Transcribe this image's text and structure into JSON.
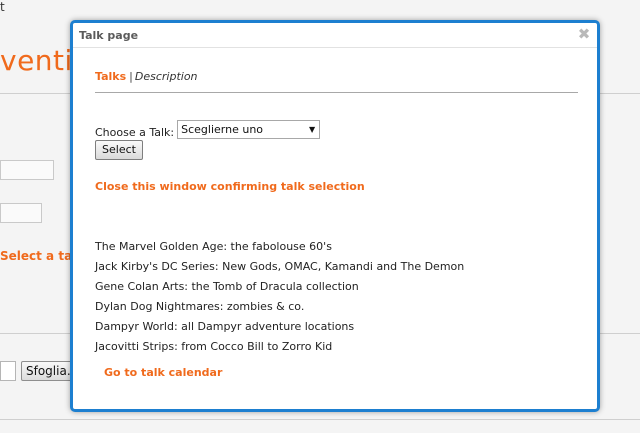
{
  "background": {
    "corner_text": "t",
    "title_fragment": "ventio",
    "select_talk_label": "Select a talk",
    "browse_button": "Sfoglia..."
  },
  "modal": {
    "title": "Talk page",
    "tabs": {
      "active": "Talks",
      "separator": "|",
      "other": "Description"
    },
    "choose_label": "Choose a Talk:",
    "select_value": "Sceglierne uno",
    "select_button": "Select",
    "confirm_link": "Close this window confirming talk selection",
    "talks": [
      "The Marvel Golden Age: the fabolouse 60's",
      "Jack Kirby's DC Series: New Gods, OMAC, Kamandi and The Demon",
      "Gene Colan Arts: the Tomb of Dracula collection",
      "Dylan Dog Nightmares: zombies & co.",
      "Dampyr World: all Dampyr adventure locations",
      "Jacovitti Strips: from Cocco Bill to Zorro Kid"
    ],
    "calendar_link": "Go to talk calendar"
  },
  "colors": {
    "accent": "#f06a1c",
    "modal_border": "#1d7fd0"
  }
}
